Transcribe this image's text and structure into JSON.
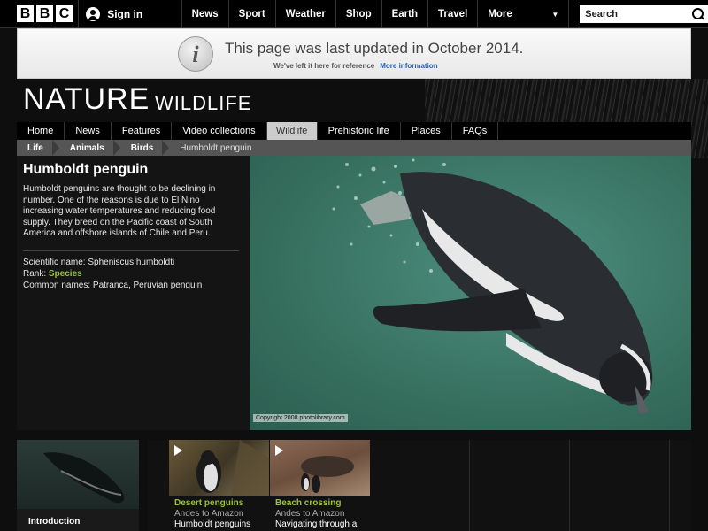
{
  "topbar": {
    "logo_letters": [
      "B",
      "B",
      "C"
    ],
    "signin": "Sign in",
    "nav": [
      "News",
      "Sport",
      "Weather",
      "Shop",
      "Earth",
      "Travel"
    ],
    "more": "More",
    "search_placeholder": "Search"
  },
  "notice": {
    "title": "This page was last updated in October 2014.",
    "sub": "We've left it here for reference",
    "link": "More information"
  },
  "header": {
    "title": "NATURE",
    "subtitle": "WILDLIFE"
  },
  "section_nav": {
    "items": [
      "Home",
      "News",
      "Features",
      "Video collections",
      "Wildlife",
      "Prehistoric life",
      "Places",
      "FAQs"
    ],
    "active": "Wildlife"
  },
  "breadcrumb": [
    "Life",
    "Animals",
    "Birds",
    "Humboldt penguin"
  ],
  "species": {
    "name": "Humboldt penguin",
    "description": "Humboldt penguins are thought to be declining in number. One of the reasons is due to El Nino increasing water temperatures and reducing food supply. They breed on the Pacific coast of South America and offshore islands of Chile and Peru.",
    "scientific_label": "Scientific name: ",
    "scientific_name": "Spheniscus humboldti",
    "rank_label": "Rank: ",
    "rank": "Species",
    "common_label": "Common names: ",
    "common_names": "Patranca, Peruvian penguin"
  },
  "photo": {
    "copyright": "Copyright 2008 photolibrary.com"
  },
  "bottom": {
    "intro_label": "Introduction",
    "videos": [
      {
        "title": "Desert penguins",
        "sub": "Andes to Amazon",
        "desc": "Humboldt penguins"
      },
      {
        "title": "Beach crossing",
        "sub": "Andes to Amazon",
        "desc": "Navigating through a"
      }
    ]
  },
  "colors": {
    "accent_green": "#9bc03a",
    "link_blue": "#2a5db0",
    "water": "#3f7d6d"
  }
}
